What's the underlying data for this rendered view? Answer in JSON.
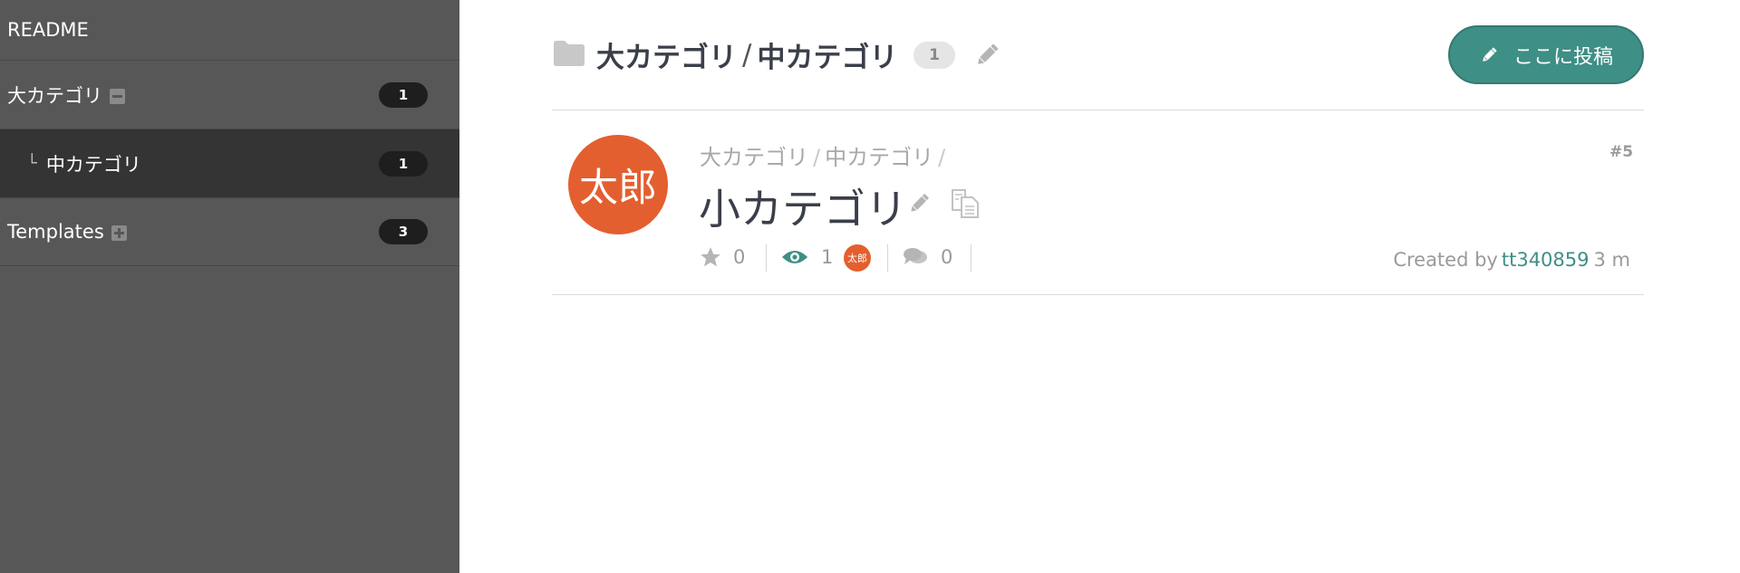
{
  "sidebar": {
    "readme_label": "README",
    "items": [
      {
        "label": "大カテゴリ",
        "count": "1",
        "toggle": "minus-icon"
      },
      {
        "label": "中カテゴリ",
        "count": "1",
        "tree_mark": "└"
      },
      {
        "label": "Templates",
        "count": "3",
        "toggle": "plus-icon"
      }
    ]
  },
  "header": {
    "breadcrumb": [
      "大カテゴリ",
      "中カテゴリ"
    ],
    "separator": "/",
    "count": "1",
    "post_button_label": "ここに投稿"
  },
  "post": {
    "avatar_text": "太郎",
    "breadcrumb": [
      "大カテゴリ",
      "中カテゴリ"
    ],
    "separator": "/",
    "title": "小カテゴリ",
    "number": "#5",
    "stars": "0",
    "watchers": "1",
    "watcher_avatar_text": "太郎",
    "comments": "0",
    "created_by_label": "Created by",
    "author": "tt340859",
    "time_ago": "3 m"
  },
  "colors": {
    "sidebar_bg": "#575757",
    "sidebar_active_bg": "#343434",
    "accent": "#3e8f85",
    "avatar": "#e35f2f"
  }
}
